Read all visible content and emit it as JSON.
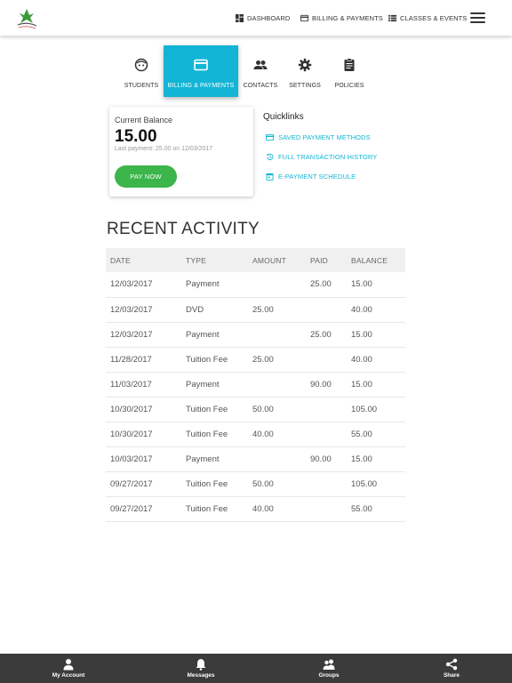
{
  "header": {
    "nav": [
      {
        "label": "DASHBOARD",
        "icon": "dashboard-icon"
      },
      {
        "label": "BILLING & PAYMENTS",
        "icon": "credit-card-icon"
      },
      {
        "label": "CLASSES & EVENTS",
        "icon": "list-icon"
      }
    ],
    "menu_icon": "hamburger-menu-icon"
  },
  "tabs": [
    {
      "label": "STUDENTS",
      "icon": "face-icon",
      "active": false
    },
    {
      "label": "BILLING & PAYMENTS",
      "icon": "credit-card-icon",
      "active": true
    },
    {
      "label": "CONTACTS",
      "icon": "people-icon",
      "active": false
    },
    {
      "label": "SETTINGS",
      "icon": "gear-icon",
      "active": false
    },
    {
      "label": "POLICIES",
      "icon": "clipboard-icon",
      "active": false
    }
  ],
  "balance": {
    "label": "Current Balance",
    "amount": "15.00",
    "last_payment": "Last payment: 25.00 on 12/03/2017",
    "pay_button": "PAY NOW"
  },
  "quicklinks": {
    "title": "Quicklinks",
    "links": [
      {
        "label": "SAVED PAYMENT METHODS",
        "icon": "credit-card-icon"
      },
      {
        "label": "FULL TRANSACTION HISTORY",
        "icon": "history-icon"
      },
      {
        "label": "E-PAYMENT SCHEDULE",
        "icon": "calendar-icon"
      }
    ]
  },
  "activity": {
    "title": "RECENT ACTIVITY",
    "columns": [
      "DATE",
      "TYPE",
      "AMOUNT",
      "PAID",
      "BALANCE"
    ],
    "rows": [
      [
        "12/03/2017",
        "Payment",
        "",
        "25.00",
        "15.00"
      ],
      [
        "12/03/2017",
        "DVD",
        "25.00",
        "",
        "40.00"
      ],
      [
        "12/03/2017",
        "Payment",
        "",
        "25.00",
        "15.00"
      ],
      [
        "11/28/2017",
        "Tuition Fee",
        "25.00",
        "",
        "40.00"
      ],
      [
        "11/03/2017",
        "Payment",
        "",
        "90.00",
        "15.00"
      ],
      [
        "10/30/2017",
        "Tuition Fee",
        "50.00",
        "",
        "105.00"
      ],
      [
        "10/30/2017",
        "Tuition Fee",
        "40.00",
        "",
        "55.00"
      ],
      [
        "10/03/2017",
        "Payment",
        "",
        "90.00",
        "15.00"
      ],
      [
        "09/27/2017",
        "Tuition Fee",
        "50.00",
        "",
        "105.00"
      ],
      [
        "09/27/2017",
        "Tuition Fee",
        "40.00",
        "",
        "55.00"
      ]
    ]
  },
  "bottom_nav": [
    {
      "label": "My Account",
      "icon": "person-icon"
    },
    {
      "label": "Messages",
      "icon": "bell-icon"
    },
    {
      "label": "Groups",
      "icon": "group-icon"
    },
    {
      "label": "Share",
      "icon": "share-icon"
    }
  ],
  "colors": {
    "accent": "#12b5d6",
    "pay_button": "#3cb54a",
    "bottom_bar": "#3b3b3b"
  }
}
